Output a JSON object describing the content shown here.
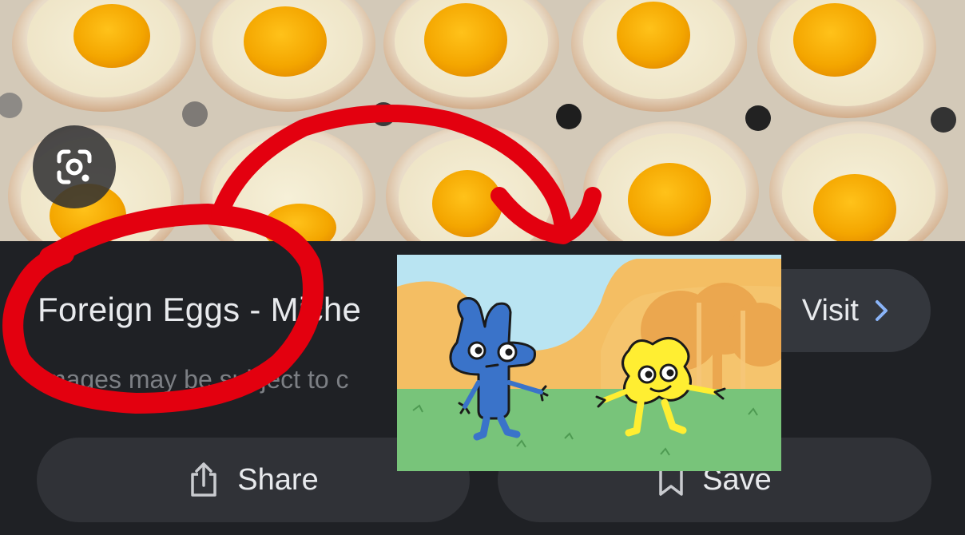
{
  "photo": {
    "description_icon": "google-lens-icon"
  },
  "result": {
    "title": "Foreign Eggs - Miche",
    "subtitle": "Images may be subject to c"
  },
  "buttons": {
    "visit_label": "Visit",
    "share_label": "Share",
    "save_label": "Save"
  },
  "icons": {
    "lens": "camera-lens-icon",
    "visit": "chevron-right-icon",
    "share": "share-icon",
    "save": "bookmark-icon"
  },
  "colors": {
    "panel_background": "#1f2125",
    "button_background": "#303237",
    "text_primary": "#e8eaed",
    "text_secondary": "#7c7f84",
    "accent_chevron": "#8ab4f8",
    "annotation_red": "#e3000f"
  }
}
